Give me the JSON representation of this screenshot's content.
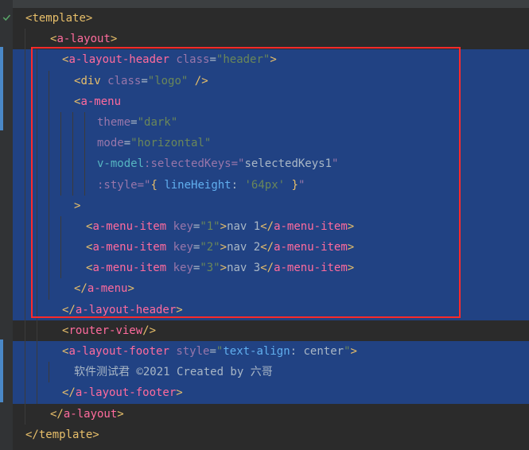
{
  "code": {
    "template_open": "template",
    "a_layout": "a-layout",
    "a_layout_header": "a-layout-header",
    "class_attr": "class",
    "header_class_val": "\"header\"",
    "div": "div",
    "logo_class_val": "\"logo\"",
    "a_menu": "a-menu",
    "theme_attr": "theme",
    "theme_val": "\"dark\"",
    "mode_attr": "mode",
    "mode_val": "\"horizontal\"",
    "vmodel": "v-model",
    "selectedKeys_attr": ":selectedKeys=\"",
    "selectedKeys_val": "selectedKeys1",
    "selectedKeys_close": "\"",
    "style_bind": ":style",
    "style_eq": "=\"",
    "brace_open": "{",
    "lineHeight": "lineHeight",
    "colon": ":",
    "sixtyfour": "'64px'",
    "brace_close": "}",
    "style_close": "\"",
    "a_menu_item": "a-menu-item",
    "key_attr": "key",
    "key1": "\"1\"",
    "key2": "\"2\"",
    "key3": "\"3\"",
    "nav1": "nav 1",
    "nav2": "nav 2",
    "nav3": "nav 3",
    "router_view": "router-view",
    "a_layout_footer": "a-layout-footer",
    "style_attr": "style",
    "footer_style_val_open": "\"",
    "text_align": "text-align",
    "center": "center",
    "footer_style_val_close": "\"",
    "footer_text": "软件测试君 ©2021 Created by 六哥"
  }
}
